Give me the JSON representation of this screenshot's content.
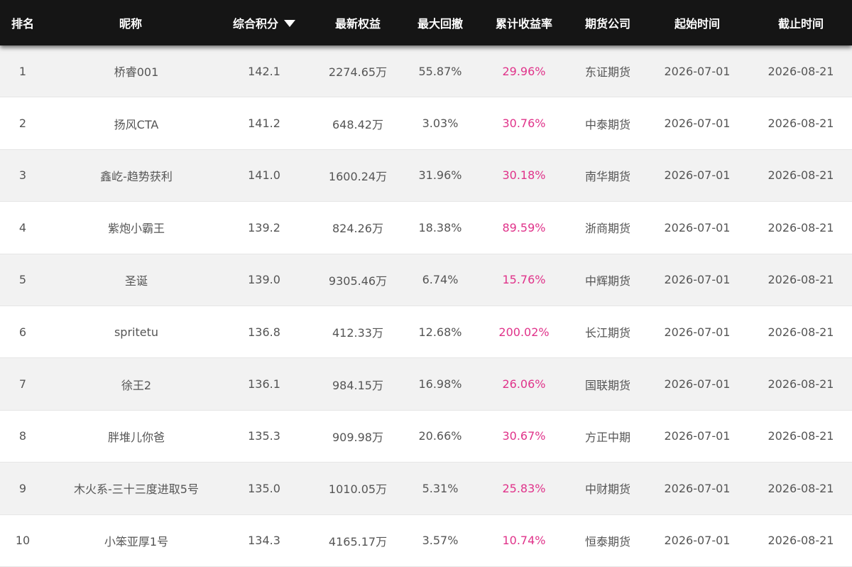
{
  "columns": {
    "rank": "排名",
    "nickname": "昵称",
    "score": "综合积分",
    "equity": "最新权益",
    "drawdown": "最大回撤",
    "return": "累计收益率",
    "company": "期货公司",
    "start": "起始时间",
    "end": "截止时间"
  },
  "sort_icon": "caret-down-icon",
  "colors": {
    "header_bg": "#151515",
    "return_color": "#e0338a",
    "odd_row_bg": "#f2f2f2"
  },
  "rows": [
    {
      "rank": "1",
      "nickname": "桥睿001",
      "score": "142.1",
      "equity": "2274.65万",
      "drawdown": "55.87%",
      "return": "29.96%",
      "company": "东证期货",
      "start": "2026-07-01",
      "end": "2026-08-21"
    },
    {
      "rank": "2",
      "nickname": "扬风CTA",
      "score": "141.2",
      "equity": "648.42万",
      "drawdown": "3.03%",
      "return": "30.76%",
      "company": "中泰期货",
      "start": "2026-07-01",
      "end": "2026-08-21"
    },
    {
      "rank": "3",
      "nickname": "鑫屹-趋势获利",
      "score": "141.0",
      "equity": "1600.24万",
      "drawdown": "31.96%",
      "return": "30.18%",
      "company": "南华期货",
      "start": "2026-07-01",
      "end": "2026-08-21"
    },
    {
      "rank": "4",
      "nickname": "紫炮小霸王",
      "score": "139.2",
      "equity": "824.26万",
      "drawdown": "18.38%",
      "return": "89.59%",
      "company": "浙商期货",
      "start": "2026-07-01",
      "end": "2026-08-21"
    },
    {
      "rank": "5",
      "nickname": "圣诞",
      "score": "139.0",
      "equity": "9305.46万",
      "drawdown": "6.74%",
      "return": "15.76%",
      "company": "中辉期货",
      "start": "2026-07-01",
      "end": "2026-08-21"
    },
    {
      "rank": "6",
      "nickname": "spritetu",
      "score": "136.8",
      "equity": "412.33万",
      "drawdown": "12.68%",
      "return": "200.02%",
      "company": "长江期货",
      "start": "2026-07-01",
      "end": "2026-08-21"
    },
    {
      "rank": "7",
      "nickname": "徐王2",
      "score": "136.1",
      "equity": "984.15万",
      "drawdown": "16.98%",
      "return": "26.06%",
      "company": "国联期货",
      "start": "2026-07-01",
      "end": "2026-08-21"
    },
    {
      "rank": "8",
      "nickname": "胖堆儿你爸",
      "score": "135.3",
      "equity": "909.98万",
      "drawdown": "20.66%",
      "return": "30.67%",
      "company": "方正中期",
      "start": "2026-07-01",
      "end": "2026-08-21"
    },
    {
      "rank": "9",
      "nickname": "木火系-三十三度进取5号",
      "score": "135.0",
      "equity": "1010.05万",
      "drawdown": "5.31%",
      "return": "25.83%",
      "company": "中财期货",
      "start": "2026-07-01",
      "end": "2026-08-21"
    },
    {
      "rank": "10",
      "nickname": "小笨亚厚1号",
      "score": "134.3",
      "equity": "4165.17万",
      "drawdown": "3.57%",
      "return": "10.74%",
      "company": "恒泰期货",
      "start": "2026-07-01",
      "end": "2026-08-21"
    }
  ]
}
